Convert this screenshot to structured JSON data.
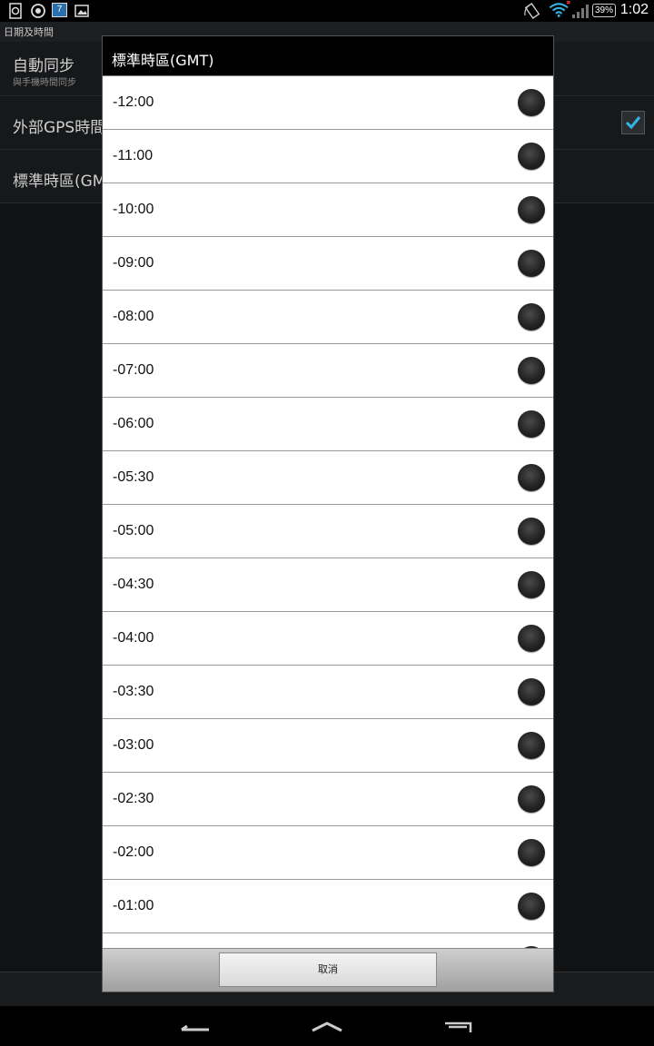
{
  "status_bar": {
    "calendar_day": "7",
    "battery_percent": "39%",
    "clock": "1:02",
    "icons": [
      "sync-notification-icon",
      "location-icon",
      "calendar-icon",
      "image-icon",
      "rotation-icon",
      "wifi-icon",
      "signal-icon",
      "battery-icon"
    ]
  },
  "app": {
    "header_title": "日期及時間",
    "settings": [
      {
        "title": "自動同步",
        "subtitle": "與手機時間同步"
      },
      {
        "title": "外部GPS時間",
        "subtitle": ""
      },
      {
        "title": "標準時區(GMT",
        "subtitle": ""
      }
    ],
    "gps_checked": true
  },
  "dialog": {
    "title": "標準時區(GMT)",
    "timezones": [
      "-12:00",
      "-11:00",
      "-10:00",
      "-09:00",
      "-08:00",
      "-07:00",
      "-06:00",
      "-05:30",
      "-05:00",
      "-04:30",
      "-04:00",
      "-03:30",
      "-03:00",
      "-02:30",
      "-02:00",
      "-01:00",
      ""
    ],
    "cancel_label": "取消"
  },
  "nav_bar": {
    "icons": [
      "back-icon",
      "home-icon",
      "recent-apps-icon"
    ]
  },
  "colors": {
    "checkbox_tick": "#33b5e5",
    "dialog_title_bg": "#000000",
    "radio_fill": "#222222"
  }
}
